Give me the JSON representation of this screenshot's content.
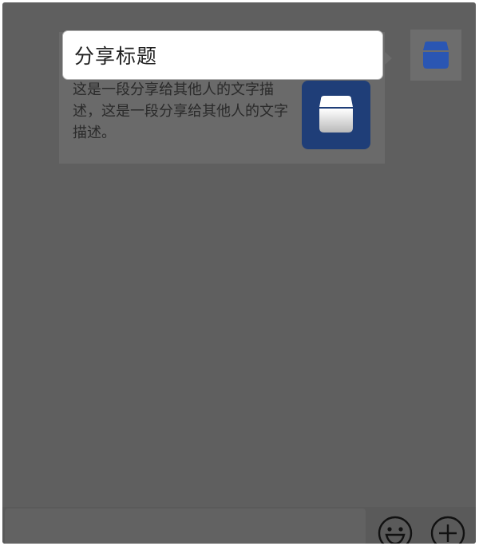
{
  "share_card": {
    "title": "分享标题",
    "description": "这是一段分享给其他人的文字描述，这是一段分享给其他人的文字描述。",
    "thumbnail_icon": "store-icon"
  },
  "sender": {
    "avatar_icon": "store-icon"
  },
  "input_bar": {
    "emoji_icon": "smiley-icon",
    "plus_icon": "plus-circle-icon"
  },
  "colors": {
    "overlay": "#5f5f5f",
    "brand_blue": "#1f3e78",
    "store_blue": "#2a56b3"
  }
}
